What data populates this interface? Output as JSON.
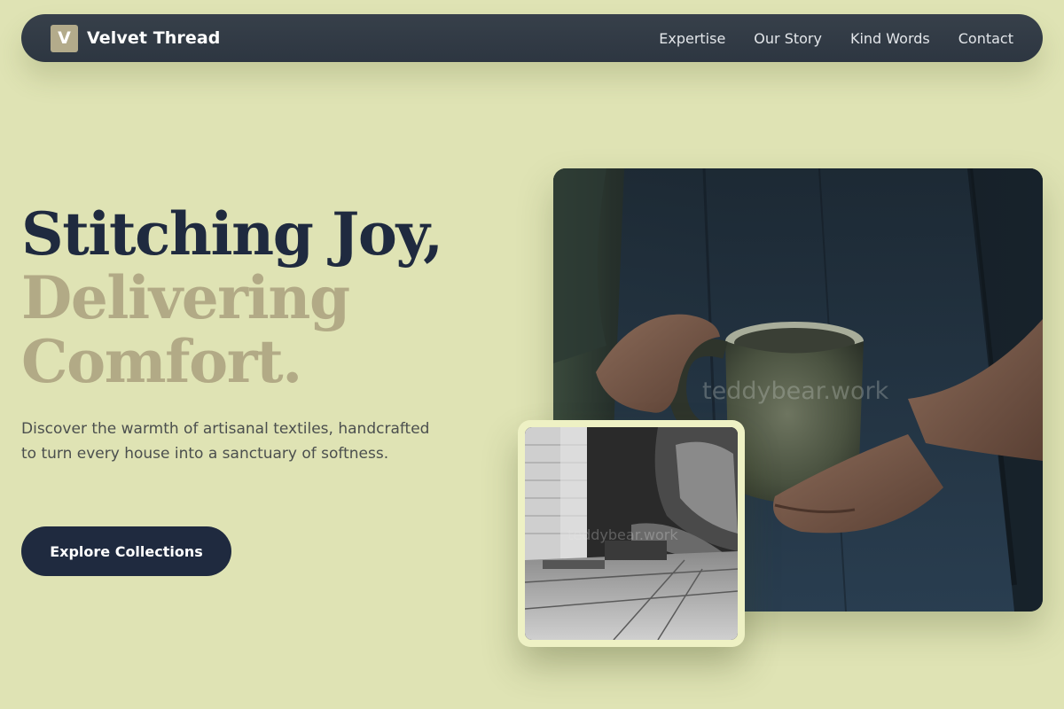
{
  "nav": {
    "logo_letter": "V",
    "brand": "Velvet Thread",
    "links": [
      "Expertise",
      "Our Story",
      "Kind Words",
      "Contact"
    ]
  },
  "hero": {
    "line1": "Stitching Joy,",
    "line2": "Delivering",
    "line3": "Comfort.",
    "subtitle": "Discover the warmth of artisanal textiles, handcrafted to turn every house into a sanctuary of softness.",
    "cta": "Explore Collections"
  },
  "images": {
    "main_watermark": "teddybear.work",
    "inset_watermark": "teddybear.work"
  },
  "colors": {
    "background": "#dfe3b4",
    "nav": "#2d3641",
    "primary": "#1f2a3f",
    "accent": "#b2aa86"
  }
}
